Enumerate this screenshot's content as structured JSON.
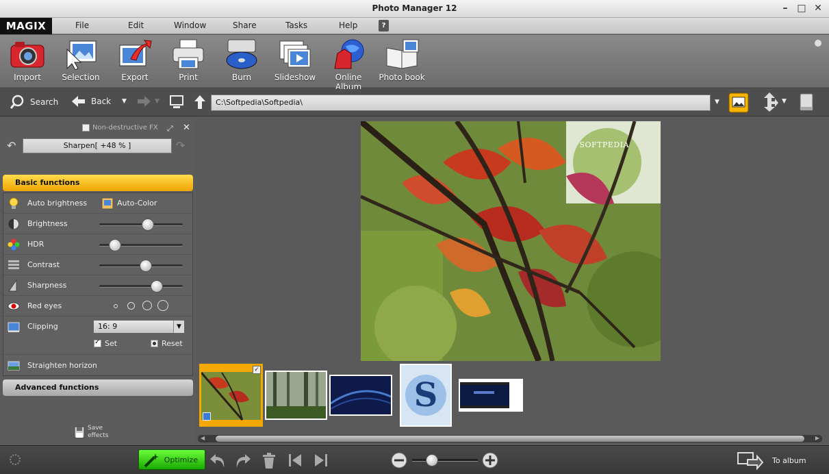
{
  "window": {
    "title": "Photo Manager 12"
  },
  "brand": {
    "logo": "MAGIX"
  },
  "menu": [
    "File",
    "Edit",
    "Window",
    "Share",
    "Tasks",
    "Help"
  ],
  "toolbar": {
    "tools": [
      {
        "label": "Import",
        "icon": "camera-icon"
      },
      {
        "label": "Selection",
        "icon": "selection-icon"
      },
      {
        "label": "Export",
        "icon": "export-icon"
      },
      {
        "label": "Print",
        "icon": "printer-icon"
      },
      {
        "label": "Burn",
        "icon": "disc-burn-icon"
      },
      {
        "label": "Slideshow",
        "icon": "slideshow-icon"
      },
      {
        "label": "Online Album",
        "icon": "globe-icon"
      },
      {
        "label": "Photo book",
        "icon": "photo-book-icon"
      }
    ]
  },
  "nav": {
    "search_label": "Search",
    "back_label": "Back",
    "path": "C:\\Softpedia\\Softpedia\\"
  },
  "effects": {
    "non_destructive_label": "Non-destructive FX",
    "current_effect": "Sharpen[ +48 % ]",
    "basic_header": "Basic functions",
    "advanced_header": "Advanced functions",
    "auto_brightness": "Auto brightness",
    "auto_color": "Auto-Color",
    "brightness": "Brightness",
    "brightness_level": 0.58,
    "hdr": "HDR",
    "hdr_level": 0.19,
    "contrast": "Contrast",
    "contrast_level": 0.56,
    "sharpness": "Sharpness",
    "sharpness_level": 0.69,
    "red_eyes": "Red eyes",
    "clipping": "Clipping",
    "clipping_ratio": "16: 9",
    "set_label": "Set",
    "reset_label": "Reset",
    "straighten": "Straighten horizon",
    "save_effects_line1": "Save",
    "save_effects_line2": "effects"
  },
  "preview": {
    "watermark": "SOFTPEDIA"
  },
  "bottom": {
    "optimize_label": "Optimize",
    "zoom_level": 0.3,
    "to_album_label": "To album"
  }
}
